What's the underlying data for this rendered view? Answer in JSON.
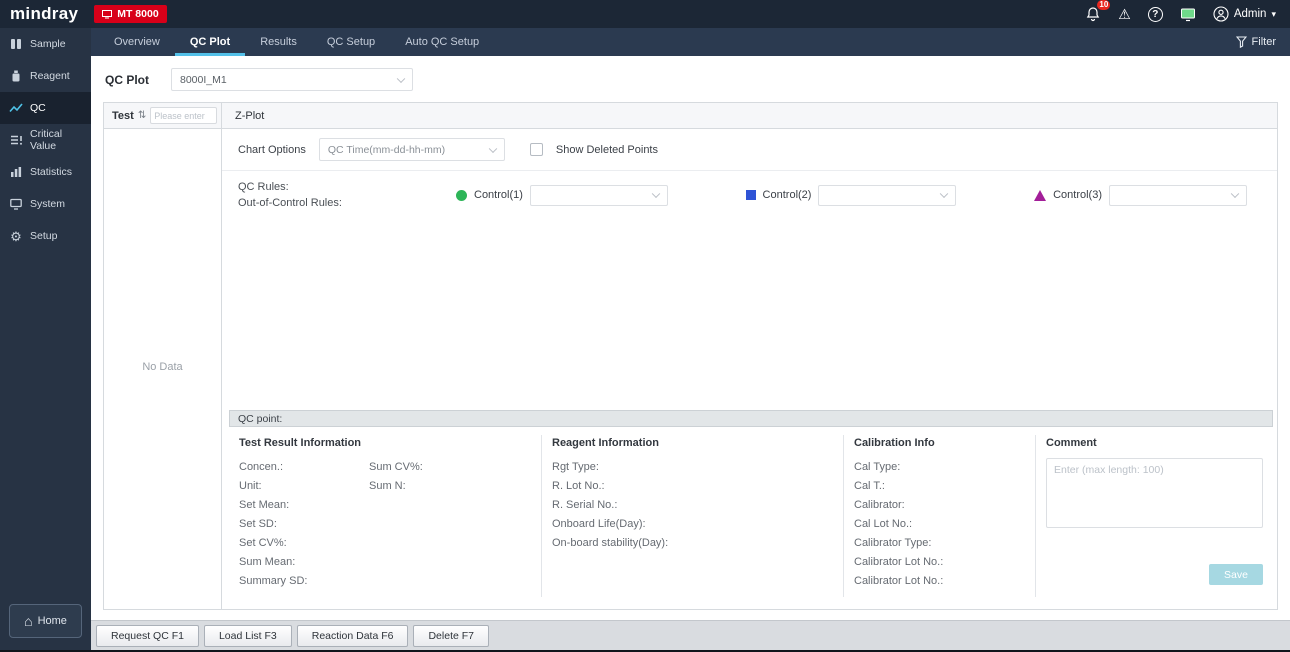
{
  "icons": {
    "warning": "⚠",
    "help": "?",
    "gear": "⚙",
    "home": "⌂",
    "sort": "⇅",
    "caret": "▾"
  },
  "topbar": {
    "logo": "mindray",
    "device": "MT 8000",
    "notifications": "10",
    "user": "Admin"
  },
  "nav": {
    "tabs": [
      {
        "label": "Overview"
      },
      {
        "label": "QC Plot"
      },
      {
        "label": "Results"
      },
      {
        "label": "QC Setup"
      },
      {
        "label": "Auto QC Setup"
      }
    ],
    "filter": "Filter"
  },
  "sidebar": {
    "items": [
      {
        "label": "Sample"
      },
      {
        "label": "Reagent"
      },
      {
        "label": "QC"
      },
      {
        "label": "Critical Value"
      },
      {
        "label": "Statistics"
      },
      {
        "label": "System"
      },
      {
        "label": "Setup"
      }
    ],
    "home": "Home"
  },
  "main": {
    "qc_plot_label": "QC Plot",
    "module_value": "8000I_M1",
    "test_panel": {
      "header": "Test",
      "search_placeholder": "Please enter",
      "empty": "No Data"
    },
    "zplot": {
      "title": "Z-Plot",
      "chart_options_label": "Chart Options",
      "chart_type_value": "QC Time(mm-dd-hh-mm)",
      "show_deleted": "Show Deleted Points",
      "qc_rules": "QC Rules:",
      "out_rules": "Out-of-Control Rules:",
      "controls": [
        {
          "label": "Control(1)",
          "marker": "circle",
          "color": "#2db558"
        },
        {
          "label": "Control(2)",
          "marker": "square",
          "color": "#2f54d6"
        },
        {
          "label": "Control(3)",
          "marker": "triangle",
          "color": "#a31e99"
        }
      ]
    },
    "qc_point": {
      "title": "QC point:",
      "test_result": {
        "title": "Test Result Information",
        "left": [
          "Concen.:",
          "Unit:",
          "Set Mean:",
          "Set SD:",
          "Set CV%:",
          "Sum Mean:",
          "Summary SD:"
        ],
        "right": [
          "Sum CV%:",
          "Sum N:"
        ]
      },
      "reagent": {
        "title": "Reagent Information",
        "labels": [
          "Rgt Type:",
          "R. Lot No.:",
          "R. Serial No.:",
          "Onboard Life(Day):",
          "On-board stability(Day):"
        ]
      },
      "calibration": {
        "title": "Calibration Info",
        "labels": [
          "Cal Type:",
          "Cal T.:",
          "Calibrator:",
          "Cal Lot No.:",
          "Calibrator Type:",
          "Calibrator Lot No.:",
          "Calibrator Lot No.:"
        ]
      },
      "comment": {
        "title": "Comment",
        "placeholder": "Enter (max length: 100)",
        "save": "Save"
      }
    }
  },
  "footer": {
    "buttons": [
      "Request QC F1",
      "Load List F3",
      "Reaction Data F6",
      "Delete F7"
    ]
  }
}
